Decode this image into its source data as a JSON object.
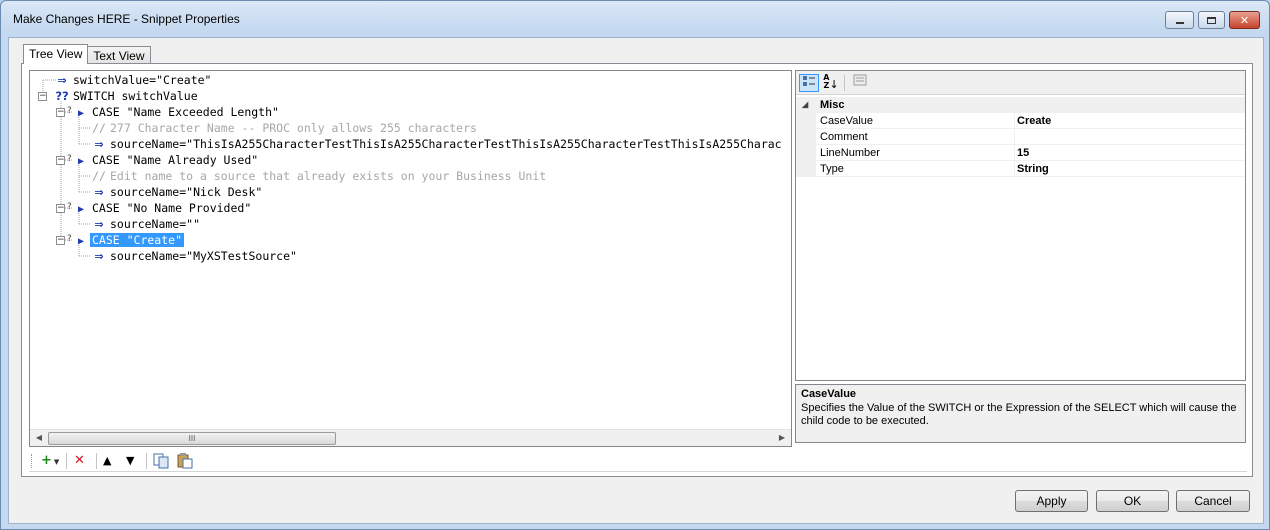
{
  "window": {
    "title": "Make Changes HERE - Snippet Properties",
    "caption_icons": {
      "minimize": "minimize-icon",
      "maximize": "maximize-icon",
      "close": "close-icon"
    }
  },
  "tabs": [
    {
      "label": "Tree View",
      "active": true
    },
    {
      "label": "Text View",
      "active": false
    }
  ],
  "tree": {
    "nodes": [
      {
        "kind": "assign",
        "text": "switchValue=\"Create\""
      },
      {
        "kind": "switch",
        "text": "SWITCH switchValue"
      },
      {
        "kind": "case",
        "text": "CASE \"Name Exceeded Length\""
      },
      {
        "kind": "comment",
        "text": "277 Character Name -- PROC only allows 255 characters"
      },
      {
        "kind": "assign",
        "text": "sourceName=\"ThisIsA255CharacterTestThisIsA255CharacterTestThisIsA255CharacterTestThisIsA255Charac"
      },
      {
        "kind": "case",
        "text": "CASE \"Name Already Used\""
      },
      {
        "kind": "comment",
        "text": "Edit name to a source that already exists on your Business Unit"
      },
      {
        "kind": "assign",
        "text": "sourceName=\"Nick Desk\""
      },
      {
        "kind": "case",
        "text": "CASE \"No Name Provided\""
      },
      {
        "kind": "assign",
        "text": "sourceName=\"\""
      },
      {
        "kind": "case",
        "text": "CASE \"Create\"",
        "selected": true
      },
      {
        "kind": "assign",
        "text": "sourceName=\"MyXSTestSource\""
      }
    ],
    "scroll_thumb_label": "III"
  },
  "tree_toolbar": {
    "add_icon": "add-icon",
    "delete_icon": "delete-icon",
    "move_up_icon": "move-up-icon",
    "move_down_icon": "move-down-icon",
    "copy_icon": "copy-icon",
    "paste_icon": "paste-icon"
  },
  "property_grid": {
    "toolbar": {
      "categorized_icon": "categorized-icon",
      "alphabetical_icon": "alphabetical-icon",
      "property_pages_icon": "property-pages-icon"
    },
    "category": "Misc",
    "rows": [
      {
        "name": "CaseValue",
        "value": "Create"
      },
      {
        "name": "Comment",
        "value": ""
      },
      {
        "name": "LineNumber",
        "value": "15"
      },
      {
        "name": "Type",
        "value": "String"
      }
    ]
  },
  "description": {
    "title": "CaseValue",
    "text": "Specifies the Value of the SWITCH or the Expression of the SELECT which will cause the child code to be executed."
  },
  "buttons": {
    "apply": "Apply",
    "ok": "OK",
    "cancel": "Cancel"
  },
  "colors": {
    "selection": "#3399ff",
    "assign_icon": "#1f3bb3",
    "comment_text": "#a7a7a7",
    "add_icon": "#1a8a1a",
    "delete_icon": "#d01818"
  }
}
